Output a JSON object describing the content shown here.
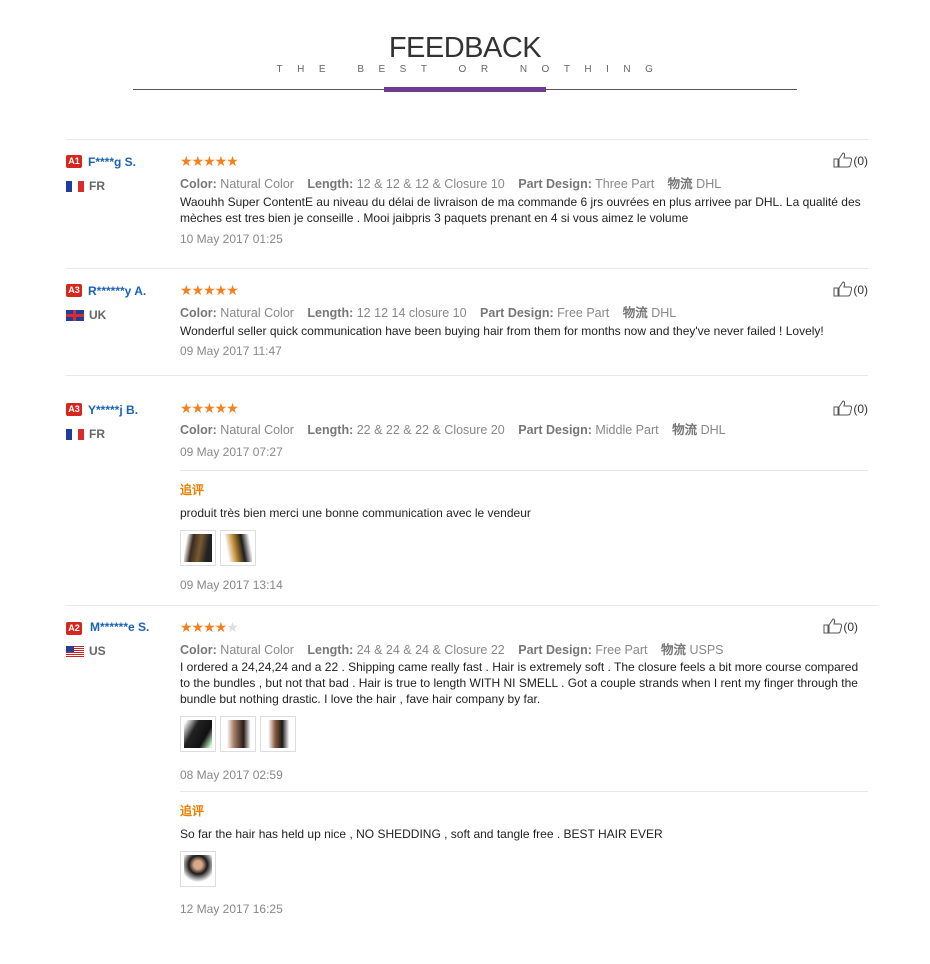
{
  "header": {
    "title": "FEEDBACK",
    "subtitle": "THE BEST OR NOTHING"
  },
  "labels": {
    "color": "Color:",
    "length": "Length:",
    "part_design": "Part Design:",
    "logistics": "物流",
    "followup": "追评"
  },
  "reviews": [
    {
      "rank": "A1",
      "user": "F****g S.",
      "country": "FR",
      "rating": 5,
      "likes": "(0)",
      "color": "Natural Color",
      "length": "12 & 12 & 12 & Closure 10",
      "part_design": "Three Part",
      "logistics": "DHL",
      "text": "Waouhh Super ContentE au niveau du délai de livraison de ma commande 6 jrs ouvrées en plus arrivee par DHL. La qualité des mèches est tres bien je conseille . Mooi jaibpris 3 paquets prenant en 4 si vous aimez le volume",
      "date": "10 May 2017 01:25"
    },
    {
      "rank": "A3",
      "user": "R******y A.",
      "country": "UK",
      "rating": 5,
      "likes": "(0)",
      "color": "Natural Color",
      "length": "12 12 14 closure 10",
      "part_design": "Free Part",
      "logistics": "DHL",
      "text": "Wonderful seller quick communication have been buying hair from them for months now and they've never failed ! Lovely!",
      "date": "09 May 2017 11:47"
    },
    {
      "rank": "A3",
      "user": "Y*****j B.",
      "country": "FR",
      "rating": 5,
      "likes": "(0)",
      "color": "Natural Color",
      "length": "22 & 22 & 22 & Closure 20",
      "part_design": "Middle Part",
      "logistics": "DHL",
      "date": "09 May 2017 07:27",
      "followup_text": "produit très bien merci une bonne communication avec le vendeur",
      "followup_date": "09 May 2017 13:14"
    },
    {
      "rank": "A2",
      "user": "M******e S.",
      "country": "US",
      "rating": 4,
      "likes": "(0)",
      "color": "Natural Color",
      "length": "24 & 24 & 24 & Closure 22",
      "part_design": "Free Part",
      "logistics": "USPS",
      "text": "I ordered a 24,24,24 and a 22 . Shipping came really fast . Hair is extremely soft . The closure feels a bit more course compared to the bundles , but not that bad . Hair is true to length WITH NI SMELL . Got a couple strands when I rent my finger through the bundle but nothing drastic. I love the hair , fave hair company by far.",
      "date": "08 May 2017 02:59",
      "followup_text": "So far the hair has held up nice , NO SHEDDING , soft and tangle free . BEST HAIR EVER",
      "followup_date": "12 May 2017 16:25"
    }
  ]
}
